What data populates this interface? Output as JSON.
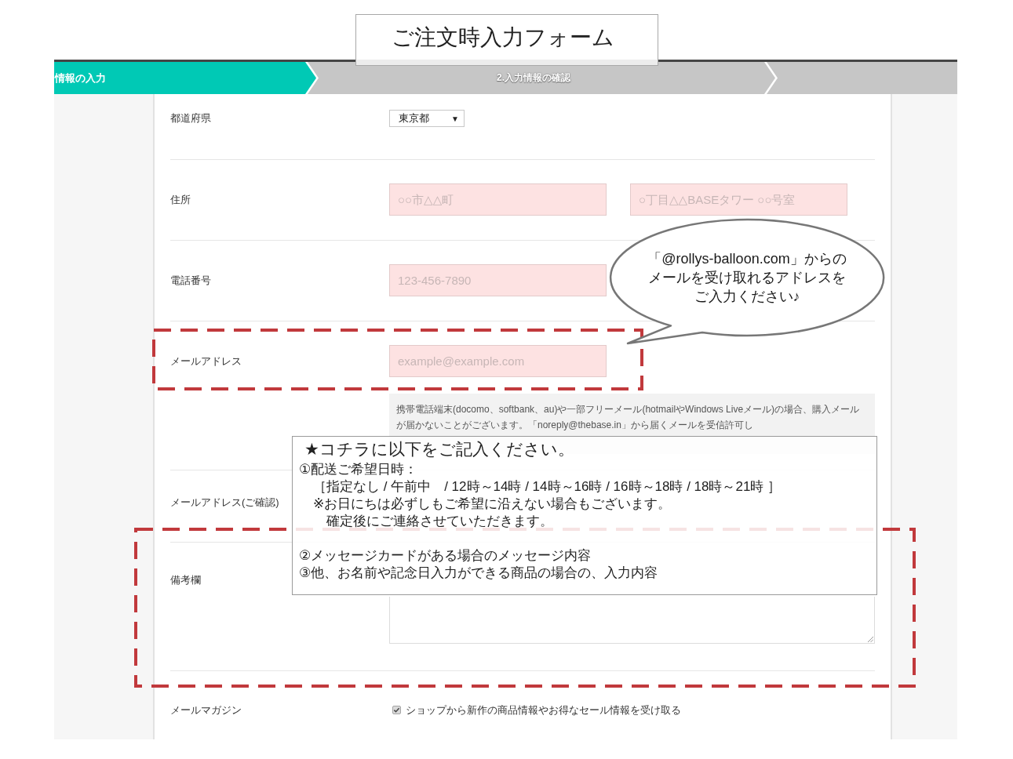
{
  "header": {
    "title": "ご注文時入力フォーム"
  },
  "steps": [
    {
      "label": "情報の入力",
      "selected": true
    },
    {
      "label": "2.入力情報の確認",
      "selected": false
    },
    {
      "selected": false
    }
  ],
  "form": {
    "rows": [
      {
        "kind": "select",
        "label": "都道府県",
        "value": "東京都",
        "caret": "▼"
      },
      {
        "kind": "text",
        "label": "住所",
        "fields": [
          {
            "placeholder": "○○市△△町"
          },
          {
            "placeholder": "○丁目△△BASEタワー ○○号室"
          }
        ]
      },
      {
        "kind": "text",
        "label": "電話番号",
        "fields": [
          {
            "placeholder": "123-456-7890"
          }
        ]
      },
      {
        "kind": "text",
        "label": "メールアドレス",
        "fields": [
          {
            "placeholder": "example@example.com"
          }
        ],
        "note": "携帯電話端末(docomo、softbank、au)や一部フリーメール(hotmailやWindows Liveメール)の場合、購入メールが届かないことがございます。「noreply@thebase.in」から届くメールを受信許可し"
      },
      {
        "kind": "covered",
        "label": "メールアドレス(ご確認)"
      },
      {
        "kind": "textarea",
        "label": "備考欄"
      },
      {
        "kind": "checkbox",
        "label": "メールマガジン",
        "option": {
          "text": "ショップから新作の商品情報やお得なセール情報を受け取る",
          "checked": true
        }
      }
    ]
  },
  "bubble": {
    "lines": [
      "「@rollys-balloon.com」からの",
      "メールを受け取れるアドレスを",
      "ご入力ください♪"
    ]
  },
  "instructions": {
    "heading": "★コチラに以下をご記入ください。",
    "items": [
      {
        "text": "①配送ご希望日時：",
        "choices": "［指定なし / 午前中　/ 12時～14時 / 14時～16時 / 16時～18時 / 18時～21時 ］",
        "note_lines": [
          "※お日にちは必ずしもご希望に沿えない場合もございます。",
          "確定後にご連絡させていただきます。"
        ]
      },
      {
        "text": "②メッセージカードがある場合のメッセージ内容"
      },
      {
        "text": "③他、お名前や記念日入力ができる商品の場合の、入力内容"
      }
    ]
  }
}
